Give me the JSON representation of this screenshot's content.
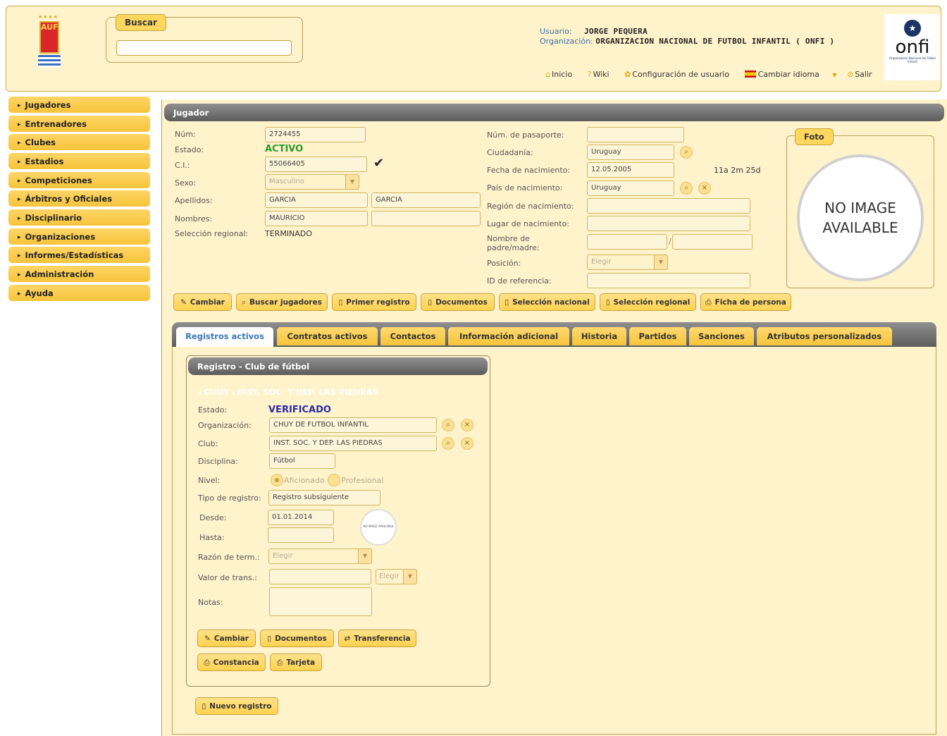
{
  "header": {
    "logo_text": "AUF",
    "search_label": "Buscar",
    "search_value": "",
    "user_label": "Usuario:",
    "user_name": "JORGE PEQUERA",
    "org_label": "Organización:",
    "org_name": "ORGANIZACION NACIONAL DE FUTBOL INFANTIL ( ONFI )",
    "onfi_logo": "onfi",
    "onfi_sub": "Organización Nacional del Fútbol Infantil",
    "links": {
      "home": "Inicio",
      "wiki": "Wiki",
      "config": "Configuración de usuario",
      "lang": "Cambiar idioma",
      "logout": "Salir"
    }
  },
  "sidebar": {
    "items": [
      "Jugadores",
      "Entrenadores",
      "Clubes",
      "Estadios",
      "Competiciones",
      "Árbitros y Oficiales",
      "Disciplinario",
      "Organizaciones",
      "Informes/Estadísticas",
      "Administración",
      "Ayuda"
    ]
  },
  "player": {
    "title": "Jugador",
    "labels": {
      "num": "Núm:",
      "estado": "Estado:",
      "ci": "C.I.:",
      "sexo": "Sexo:",
      "apellidos": "Apellidos:",
      "nombres": "Nombres:",
      "seleccion": "Selección regional:",
      "pasaporte": "Núm. de pasaporte:",
      "ciudadania": "Ciudadanía:",
      "fnac": "Fecha de nacimiento:",
      "pais": "País de nacimiento:",
      "region": "Región de nacimiento:",
      "lugar": "Lugar de nacimiento:",
      "padre": "Nombre de padre/madre:",
      "posicion": "Posición:",
      "referencia": "ID de referencia:"
    },
    "num": "2724455",
    "estado": "ACTIVO",
    "ci": "55066405",
    "sexo": "Masculino",
    "apellido1": "GARCIA",
    "apellido2": "GARCIA",
    "nombre1": "MAURICIO",
    "nombre2": "",
    "seleccion": "TERMINADO",
    "pasaporte": "",
    "ciudadania": "Uruguay",
    "fnac": "12.05.2005",
    "edad": "11a 2m 25d",
    "pais": "Uruguay",
    "region": "",
    "lugar": "",
    "padre1": "",
    "padre2": "",
    "posicion": "Elegir",
    "referencia": "",
    "foto_label": "Foto",
    "no_image": "NO IMAGE AVAILABLE"
  },
  "actions": [
    "Cambiar",
    "Buscar jugadores",
    "Primer registro",
    "Documentos",
    "Selección nacional",
    "Selección regional",
    "Ficha de persona"
  ],
  "tabs": [
    "Registros activos",
    "Contratos activos",
    "Contactos",
    "Información adicional",
    "Historia",
    "Partidos",
    "Sanciones",
    "Atributos personalizados"
  ],
  "registro": {
    "title": "Registro - Club de fútbol",
    "breadcrumb": [
      "CHUY",
      "INST. SOC. Y DEP. LAS PIEDRAS"
    ],
    "labels": {
      "estado": "Estado:",
      "org": "Organización:",
      "club": "Club:",
      "disciplina": "Disciplina:",
      "nivel": "Nivel:",
      "tipo": "Tipo de registro:",
      "desde": "Desde:",
      "hasta": "Hasta:",
      "razon": "Razón de term.:",
      "valor": "Valor de trans.:",
      "notas": "Notas:"
    },
    "estado": "VERIFICADO",
    "org": "CHUY DE FUTBOL INFANTIL",
    "club": "INST. SOC. Y DEP. LAS PIEDRAS",
    "disciplina": "Fútbol",
    "nivel_opts": [
      "Aficionado",
      "Profesional"
    ],
    "tipo": "Registro subsiguiente",
    "desde": "01.01.2014",
    "hasta": "",
    "razon": "Elegir",
    "valor": "",
    "moneda": "Elegir",
    "notas": "",
    "mini_noimg": "NO IMAGE AVAILABLE",
    "buttons": [
      "Cambiar",
      "Documentos",
      "Transferencia",
      "Constancia",
      "Tarjeta"
    ]
  },
  "nuevo_registro": "Nuevo registro"
}
